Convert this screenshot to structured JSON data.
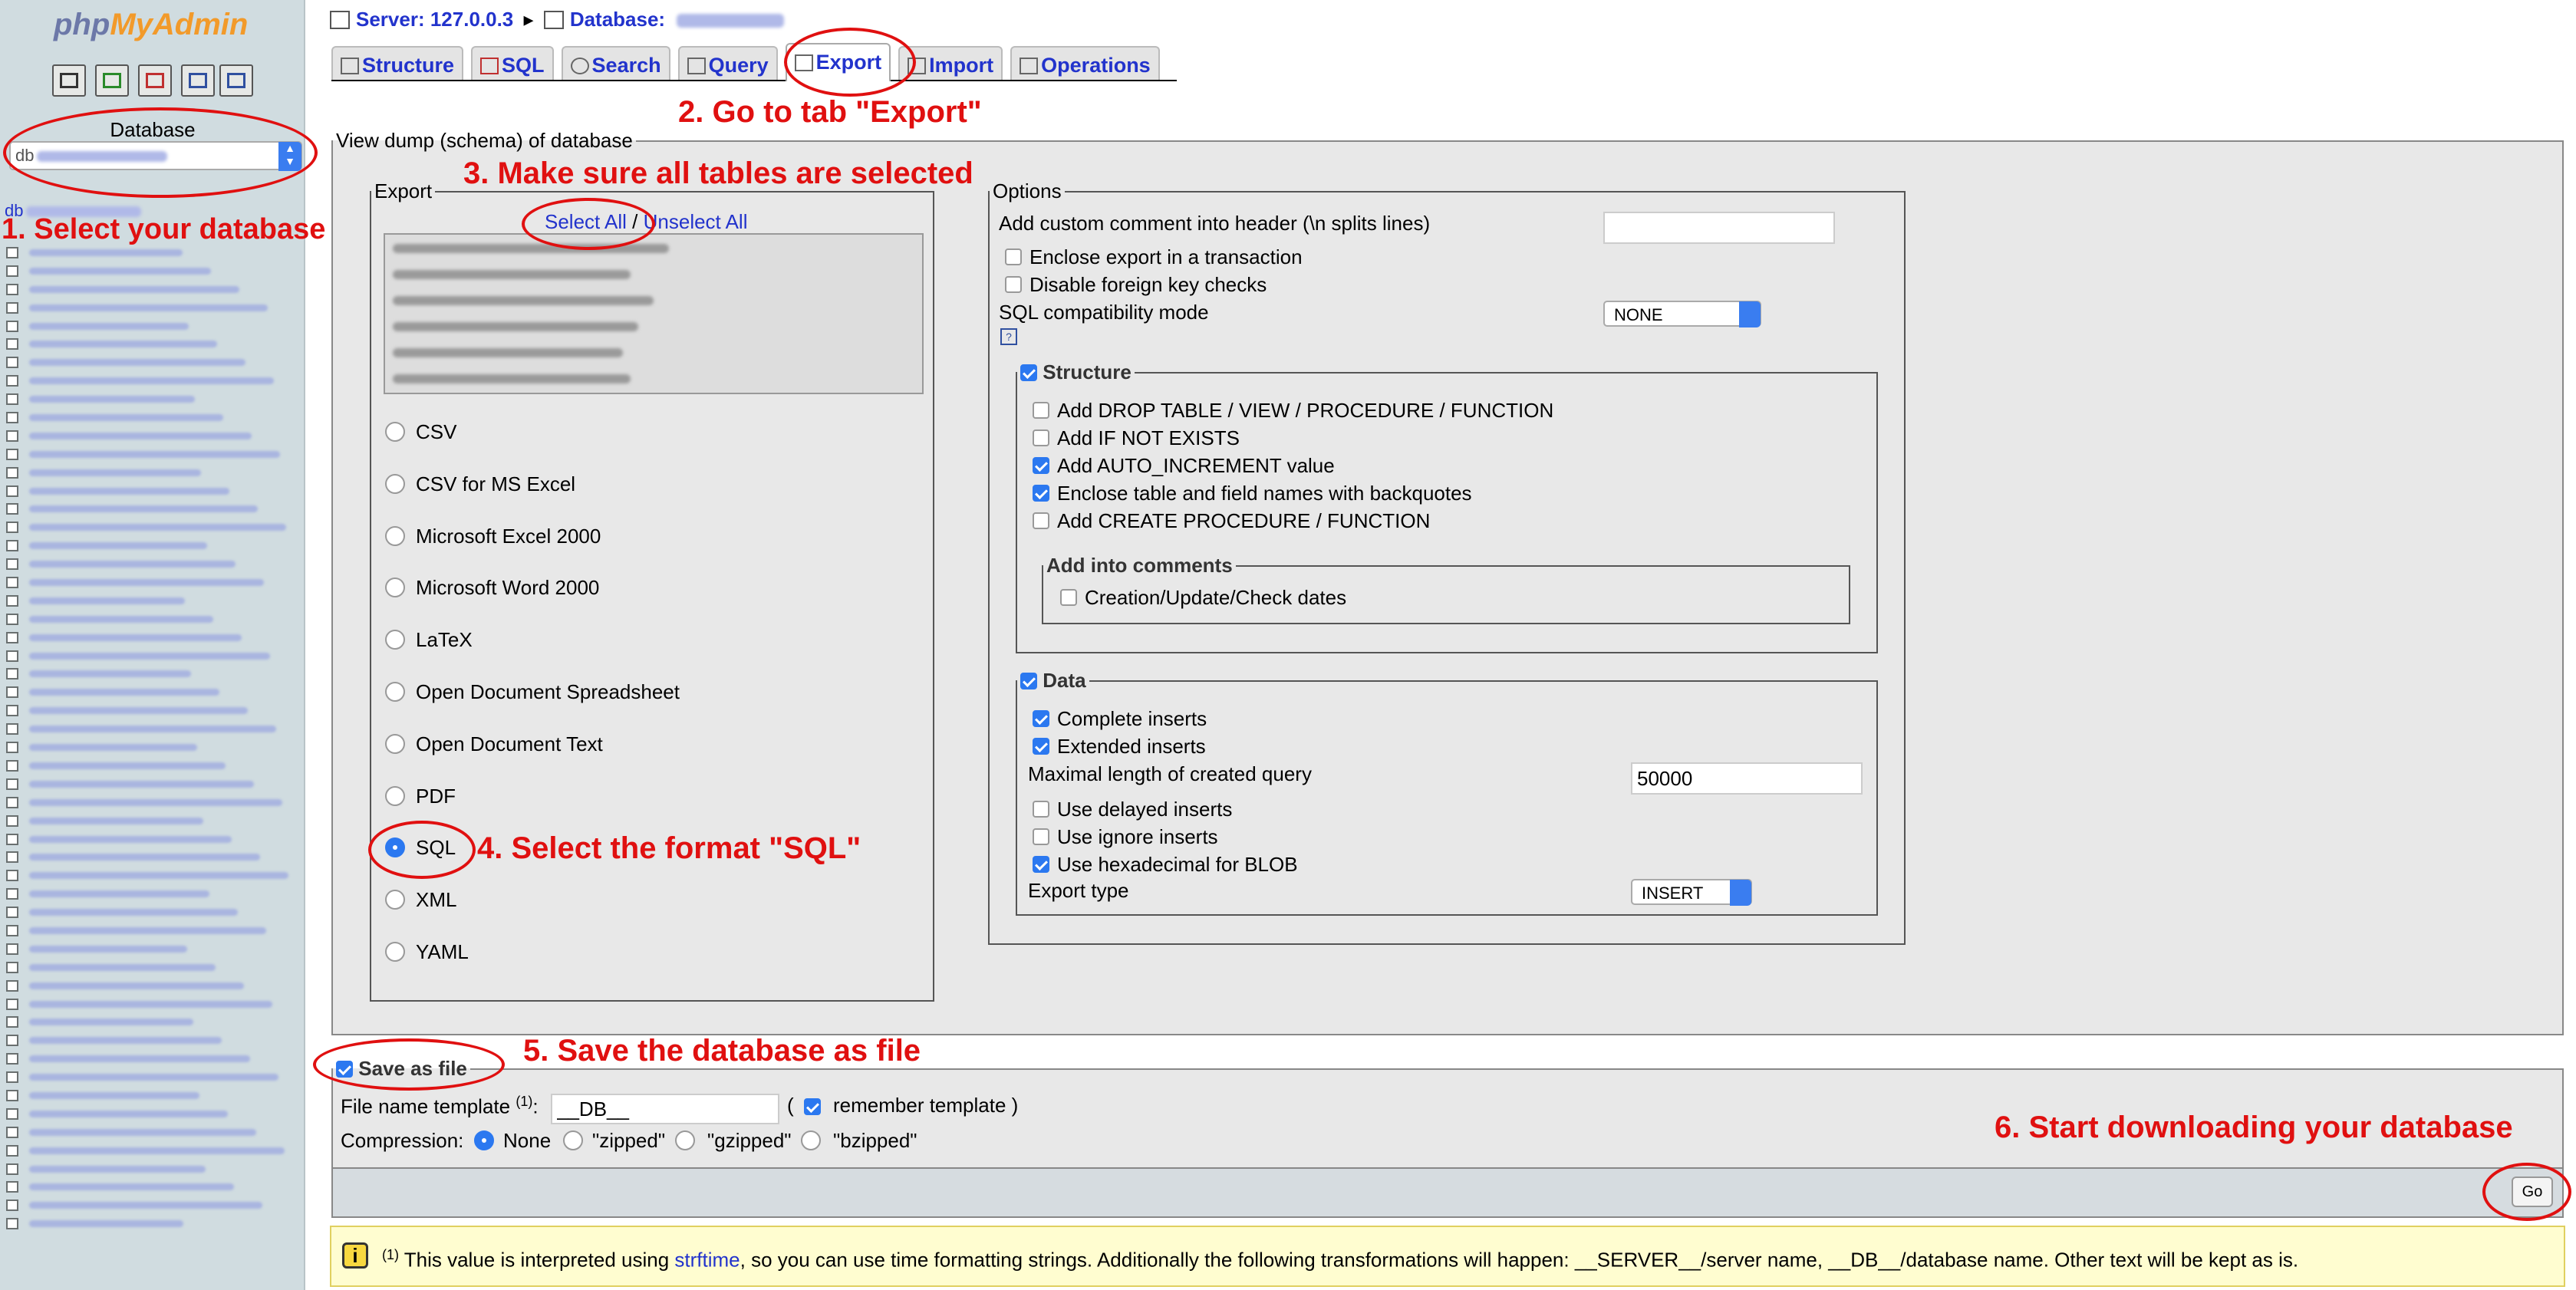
{
  "nav": {
    "logo_php": "php",
    "logo_myadmin": "MyAdmin",
    "icons": [
      "home-icon",
      "database-icon",
      "sql-icon",
      "docs-icon",
      "settings-icon"
    ],
    "database_label": "Database",
    "database_prefix": "db",
    "current_db_prefix": "db",
    "table_count": 54
  },
  "breadcrumb": {
    "server": "Server: 127.0.0.3",
    "database": "Database:"
  },
  "tabs": [
    {
      "label": "Structure"
    },
    {
      "label": "SQL"
    },
    {
      "label": "Search"
    },
    {
      "label": "Query"
    },
    {
      "label": "Export",
      "active": true
    },
    {
      "label": "Import"
    },
    {
      "label": "Operations"
    }
  ],
  "main_legend": "View dump (schema) of database",
  "export": {
    "legend": "Export",
    "select_all": "Select All",
    "separator": " / ",
    "unselect_all": "Unselect All",
    "formats": [
      "CSV",
      "CSV for MS Excel",
      "Microsoft Excel 2000",
      "Microsoft Word 2000",
      "LaTeX",
      "Open Document Spreadsheet",
      "Open Document Text",
      "PDF",
      "SQL",
      "XML",
      "YAML"
    ],
    "selected_format": "SQL"
  },
  "options": {
    "legend": "Options",
    "custom_comment": "Add custom comment into header (\\n splits lines)",
    "enclose_transaction": "Enclose export in a transaction",
    "disable_fk": "Disable foreign key checks",
    "compat_label": "SQL compatibility mode",
    "compat_value": "NONE",
    "help_glyph": "?",
    "structure": {
      "legend": "Structure",
      "drop_table": "Add DROP TABLE / VIEW / PROCEDURE / FUNCTION",
      "if_not_exists": "Add IF NOT EXISTS",
      "auto_increment": "Add AUTO_INCREMENT value",
      "backquotes": "Enclose table and field names with backquotes",
      "create_procedure": "Add CREATE PROCEDURE / FUNCTION",
      "comments_legend": "Add into comments",
      "dates": "Creation/Update/Check dates"
    },
    "data": {
      "legend": "Data",
      "complete_inserts": "Complete inserts",
      "extended_inserts": "Extended inserts",
      "max_length_label": "Maximal length of created query",
      "max_length_value": "50000",
      "delayed_inserts": "Use delayed inserts",
      "ignore_inserts": "Use ignore inserts",
      "hex_blob": "Use hexadecimal for BLOB",
      "export_type_label": "Export type",
      "export_type_value": "INSERT"
    }
  },
  "save": {
    "legend": "Save as file",
    "template_label": "File name template ",
    "template_sup": "(1)",
    "template_colon": ":",
    "template_value": "__DB__",
    "paren_open": "(",
    "remember": "remember template",
    "paren_close": ")",
    "compression_label": "Compression:",
    "none": "None",
    "zipped": "\"zipped\"",
    "gzipped": "\"gzipped\"",
    "bzipped": "\"bzipped\"",
    "go": "Go"
  },
  "notice": {
    "icon": "i",
    "sup": "(1)",
    "text_before": " This value is interpreted using ",
    "link": "strftime",
    "text_after": ", so you can use time formatting strings. Additionally the following transformations will happen: __SERVER__/server name, __DB__/database name. Other text will be kept as is."
  },
  "annotations": {
    "a1": "1. Select your database",
    "a2": "2. Go to tab \"Export\"",
    "a3": "3. Make sure all tables are selected",
    "a4": "4. Select the format \"SQL\"",
    "a5": "5. Save the database as file",
    "a6": "6. Start downloading your database"
  },
  "colors": {
    "annotation": "#e01010",
    "link": "#2233cc",
    "checkbox": "#2b78f0",
    "nav_bg": "#d0dce0"
  }
}
